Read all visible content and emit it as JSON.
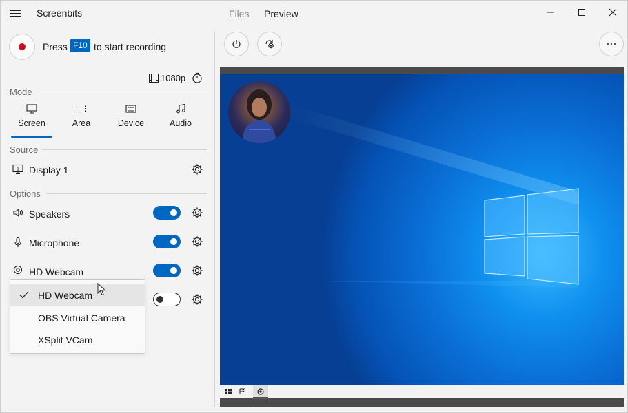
{
  "app": {
    "title": "Screenbits",
    "tabs": [
      {
        "label": "Files",
        "active": false
      },
      {
        "label": "Preview",
        "active": true
      }
    ]
  },
  "recording": {
    "press_text": "Press",
    "hotkey": "F10",
    "suffix_text": "to start recording",
    "resolution": "1080p"
  },
  "mode": {
    "label": "Mode",
    "items": [
      {
        "label": "Screen",
        "icon": "monitor-icon",
        "active": true
      },
      {
        "label": "Area",
        "icon": "area-select-icon",
        "active": false
      },
      {
        "label": "Device",
        "icon": "device-icon",
        "active": false
      },
      {
        "label": "Audio",
        "icon": "music-note-icon",
        "active": false
      }
    ]
  },
  "source": {
    "label": "Source",
    "display": "Display 1"
  },
  "options": {
    "label": "Options",
    "items": [
      {
        "label": "Speakers",
        "icon": "speaker-icon",
        "enabled": true
      },
      {
        "label": "Microphone",
        "icon": "microphone-icon",
        "enabled": true
      },
      {
        "label": "HD Webcam",
        "icon": "webcam-icon",
        "enabled": true
      },
      {
        "label": "",
        "icon": "",
        "enabled": false
      }
    ]
  },
  "webcam_dropdown": {
    "options": [
      "HD Webcam",
      "OBS Virtual Camera",
      "XSplit VCam"
    ],
    "selected": "HD Webcam"
  },
  "colors": {
    "accent": "#0067c0",
    "record": "#c50f1f"
  }
}
